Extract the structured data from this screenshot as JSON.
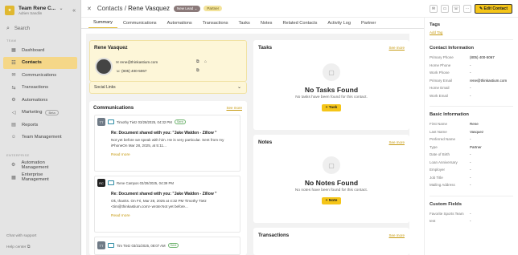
{
  "sidebar": {
    "team_name": "Team Rene C...",
    "team_user": "Adrien Sandlin",
    "search": "Search",
    "section_team": "TEAM",
    "items": [
      {
        "label": "Dashboard"
      },
      {
        "label": "Contacts"
      },
      {
        "label": "Communications"
      },
      {
        "label": "Transactions"
      },
      {
        "label": "Automations"
      },
      {
        "label": "Marketing",
        "badge": "Beta"
      },
      {
        "label": "Reports"
      },
      {
        "label": "Team Management"
      }
    ],
    "section_enterprise": "ENTERPRISE",
    "items2": [
      {
        "label": "Automation Management"
      },
      {
        "label": "Enterprise Management"
      }
    ],
    "footer_chat": "Chat with support",
    "footer_help": "Help center"
  },
  "header": {
    "breadcrumb_root": "Contacts",
    "separator": "/",
    "contact_name": "Rene Vasquez",
    "status": "New Lead",
    "type": "Partner",
    "edit_label": "Edit Contact"
  },
  "tabs": [
    {
      "label": "Summary"
    },
    {
      "label": "Communications"
    },
    {
      "label": "Automations"
    },
    {
      "label": "Transactions"
    },
    {
      "label": "Tasks"
    },
    {
      "label": "Notes"
    },
    {
      "label": "Related Contacts"
    },
    {
      "label": "Activity Log"
    },
    {
      "label": "Partner"
    }
  ],
  "profile": {
    "name": "Rene Vasquez",
    "email": "rene@thinkastium.com",
    "phone": "(805) 400-5067",
    "social_links": "Social Links"
  },
  "communications": {
    "title": "Communications",
    "see_more": "See more",
    "items": [
      {
        "initials": "TT",
        "from": "Timothy Tietz",
        "date": "03/28/2025, 04:32 PM",
        "status": "Sent",
        "subject": "Re: Document shared with you: \"Jake Waldon - Zillow \"",
        "body": "Not yet before we speak with him. He is very particular. Sent from my iPhoneOn Mar 28, 2025, at 5:11...",
        "read_more": "Read more"
      },
      {
        "initials": "RC",
        "from": "Rene Campos",
        "date": "03/28/2025, 04:39 PM",
        "subject": "Re: Document shared with you: \"Jake Waldon - Zillow \"",
        "body": "Ok, thanks. On Fri, Mar 28, 2025 at 4:32 PM Timothy Tietz <tim@thinkastium.com> wrote:Not yet before...",
        "read_more": "Read more"
      },
      {
        "initials": "TT",
        "from": "Tim Tietz",
        "date": "03/31/2025, 08:07 AM",
        "status": "Sent"
      }
    ]
  },
  "tasks": {
    "title": "Tasks",
    "see_more": "See more",
    "empty_title": "No Tasks Found",
    "empty_sub": "No tasks have been found for this contact.",
    "button": "+ Task"
  },
  "notes": {
    "title": "Notes",
    "see_more": "See more",
    "empty_title": "No Notes Found",
    "empty_sub": "No notes have been found for this contact.",
    "button": "+ Note"
  },
  "transactions": {
    "title": "Transactions",
    "see_more": "See more"
  },
  "right_panel": {
    "tags_title": "Tags",
    "add_tag": "Add Tag",
    "contact_info_title": "Contact Information",
    "contact_info": [
      {
        "k": "Primary Phone",
        "v": "(805) 400-5067"
      },
      {
        "k": "Home Phone",
        "v": "-"
      },
      {
        "k": "Work Phone",
        "v": "-"
      },
      {
        "k": "Primary Email",
        "v": "rene@thinkastium.com"
      },
      {
        "k": "Home Email",
        "v": "-"
      },
      {
        "k": "Work Email",
        "v": "-"
      }
    ],
    "basic_info_title": "Basic Information",
    "basic_info": [
      {
        "k": "First Name",
        "v": "Rene"
      },
      {
        "k": "Last Name",
        "v": "Vasquez"
      },
      {
        "k": "Preferred Name",
        "v": "-"
      },
      {
        "k": "Type",
        "v": "Partner"
      },
      {
        "k": "Date of Birth",
        "v": "-"
      },
      {
        "k": "Loan Anniversary",
        "v": "-"
      },
      {
        "k": "Employer",
        "v": "-"
      },
      {
        "k": "Job Title",
        "v": "-"
      },
      {
        "k": "Mailing Address",
        "v": "-"
      }
    ],
    "custom_title": "Custom Fields",
    "custom": [
      {
        "k": "Favorite Sports Team",
        "v": "-"
      },
      {
        "k": "test",
        "v": "-"
      }
    ]
  }
}
